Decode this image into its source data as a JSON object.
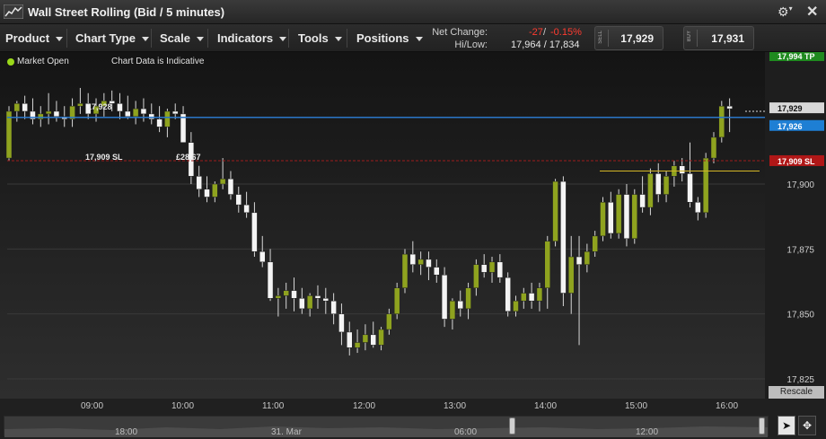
{
  "window": {
    "title": "Wall Street Rolling (Bid / 5 minutes)"
  },
  "toolbar": {
    "menus": [
      "Product",
      "Chart Type",
      "Scale",
      "Indicators",
      "Tools",
      "Positions"
    ],
    "net_change_label": "Net Change:",
    "net_change_points": "-27",
    "net_change_percent": "-0.15%",
    "hilow_label": "Hi/Low:",
    "hilow_value": "17,964 / 17,834",
    "sell_label": "SELL",
    "sell_price": "17,929",
    "buy_label": "BUY",
    "buy_price": "17,931"
  },
  "status": {
    "market": "Market Open",
    "indicative": "Chart Data is Indicative"
  },
  "chart_data": {
    "type": "candlestick",
    "y_ticks": [
      "17,900",
      "17,875",
      "17,850",
      "17,825"
    ],
    "x_ticks": [
      "09:00",
      "10:00",
      "11:00",
      "12:00",
      "13:00",
      "14:00",
      "15:00",
      "16:00"
    ],
    "ylim": [
      17820,
      17965
    ],
    "price_markers": [
      {
        "label": "17,994 TP",
        "value": 17994,
        "color": "#1f8a1f"
      },
      {
        "label": "17,929",
        "value": 17929,
        "color": "#d8d8d8"
      },
      {
        "label": "17,926",
        "value": 17926,
        "color": "#1e7fd4"
      },
      {
        "label": "17,909 SL",
        "value": 17909,
        "color": "#b01717"
      }
    ],
    "chart_labels": [
      {
        "text": "17,909 SL"
      },
      {
        "text": "£28.67"
      },
      {
        "text": "17,928"
      }
    ],
    "candles": [
      [
        17910,
        17930,
        17909,
        17928
      ],
      [
        17928,
        17932,
        17924,
        17931
      ],
      [
        17931,
        17934,
        17925,
        17928
      ],
      [
        17928,
        17933,
        17923,
        17925
      ],
      [
        17925,
        17930,
        17922,
        17927
      ],
      [
        17927,
        17935,
        17923,
        17928
      ],
      [
        17928,
        17932,
        17924,
        17926
      ],
      [
        17926,
        17930,
        17922,
        17925
      ],
      [
        17925,
        17933,
        17922,
        17930
      ],
      [
        17930,
        17937,
        17927,
        17931
      ],
      [
        17931,
        17935,
        17925,
        17927
      ],
      [
        17927,
        17933,
        17924,
        17930
      ],
      [
        17930,
        17935,
        17926,
        17932
      ],
      [
        17932,
        17936,
        17928,
        17931
      ],
      [
        17931,
        17935,
        17925,
        17928
      ],
      [
        17928,
        17934,
        17925,
        17926
      ],
      [
        17926,
        17932,
        17923,
        17929
      ],
      [
        17929,
        17933,
        17924,
        17927
      ],
      [
        17927,
        17931,
        17923,
        17925
      ],
      [
        17925,
        17930,
        17920,
        17922
      ],
      [
        17922,
        17929,
        17918,
        17928
      ],
      [
        17928,
        17931,
        17925,
        17927
      ],
      [
        17927,
        17930,
        17916,
        17916
      ],
      [
        17916,
        17920,
        17900,
        17903
      ],
      [
        17903,
        17907,
        17895,
        17898
      ],
      [
        17898,
        17903,
        17893,
        17895
      ],
      [
        17895,
        17901,
        17893,
        17900
      ],
      [
        17900,
        17910,
        17898,
        17902
      ],
      [
        17902,
        17905,
        17894,
        17896
      ],
      [
        17896,
        17899,
        17889,
        17892
      ],
      [
        17892,
        17897,
        17887,
        17889
      ],
      [
        17889,
        17893,
        17872,
        17874
      ],
      [
        17874,
        17880,
        17868,
        17870
      ],
      [
        17870,
        17875,
        17855,
        17856
      ],
      [
        17856,
        17860,
        17849,
        17857
      ],
      [
        17857,
        17862,
        17852,
        17859
      ],
      [
        17859,
        17864,
        17851,
        17856
      ],
      [
        17856,
        17860,
        17850,
        17852
      ],
      [
        17852,
        17858,
        17849,
        17857
      ],
      [
        17857,
        17861,
        17852,
        17856
      ],
      [
        17856,
        17860,
        17850,
        17855
      ],
      [
        17855,
        17858,
        17846,
        17850
      ],
      [
        17850,
        17854,
        17838,
        17843
      ],
      [
        17843,
        17847,
        17834,
        17837
      ],
      [
        17837,
        17844,
        17835,
        17839
      ],
      [
        17839,
        17846,
        17836,
        17842
      ],
      [
        17842,
        17847,
        17837,
        17838
      ],
      [
        17838,
        17845,
        17836,
        17844
      ],
      [
        17844,
        17852,
        17842,
        17850
      ],
      [
        17850,
        17862,
        17848,
        17860
      ],
      [
        17860,
        17875,
        17858,
        17873
      ],
      [
        17873,
        17878,
        17866,
        17869
      ],
      [
        17869,
        17874,
        17865,
        17871
      ],
      [
        17871,
        17874,
        17863,
        17868
      ],
      [
        17868,
        17871,
        17862,
        17865
      ],
      [
        17865,
        17868,
        17845,
        17848
      ],
      [
        17848,
        17856,
        17844,
        17855
      ],
      [
        17855,
        17859,
        17849,
        17852
      ],
      [
        17852,
        17862,
        17848,
        17860
      ],
      [
        17860,
        17871,
        17857,
        17869
      ],
      [
        17869,
        17873,
        17864,
        17866
      ],
      [
        17866,
        17872,
        17862,
        17870
      ],
      [
        17870,
        17873,
        17862,
        17864
      ],
      [
        17864,
        17866,
        17849,
        17851
      ],
      [
        17851,
        17857,
        17849,
        17855
      ],
      [
        17855,
        17860,
        17852,
        17858
      ],
      [
        17858,
        17862,
        17852,
        17855
      ],
      [
        17855,
        17862,
        17851,
        17860
      ],
      [
        17860,
        17880,
        17852,
        17878
      ],
      [
        17878,
        17902,
        17876,
        17901
      ],
      [
        17901,
        17903,
        17853,
        17858
      ],
      [
        17858,
        17880,
        17850,
        17872
      ],
      [
        17872,
        17880,
        17838,
        17869
      ],
      [
        17869,
        17877,
        17866,
        17874
      ],
      [
        17874,
        17882,
        17872,
        17880
      ],
      [
        17880,
        17895,
        17878,
        17893
      ],
      [
        17893,
        17897,
        17879,
        17881
      ],
      [
        17881,
        17898,
        17879,
        17896
      ],
      [
        17896,
        17900,
        17876,
        17879
      ],
      [
        17879,
        17898,
        17877,
        17896
      ],
      [
        17896,
        17903,
        17889,
        17891
      ],
      [
        17891,
        17906,
        17888,
        17904
      ],
      [
        17904,
        17908,
        17893,
        17896
      ],
      [
        17896,
        17905,
        17893,
        17903
      ],
      [
        17903,
        17909,
        17899,
        17907
      ],
      [
        17907,
        17910,
        17901,
        17904
      ],
      [
        17904,
        17916,
        17891,
        17893
      ],
      [
        17893,
        17895,
        17886,
        17889
      ],
      [
        17889,
        17912,
        17887,
        17910
      ],
      [
        17910,
        17920,
        17908,
        17918
      ],
      [
        17918,
        17932,
        17916,
        17930
      ],
      [
        17930,
        17933,
        17920,
        17929
      ]
    ]
  }
}
